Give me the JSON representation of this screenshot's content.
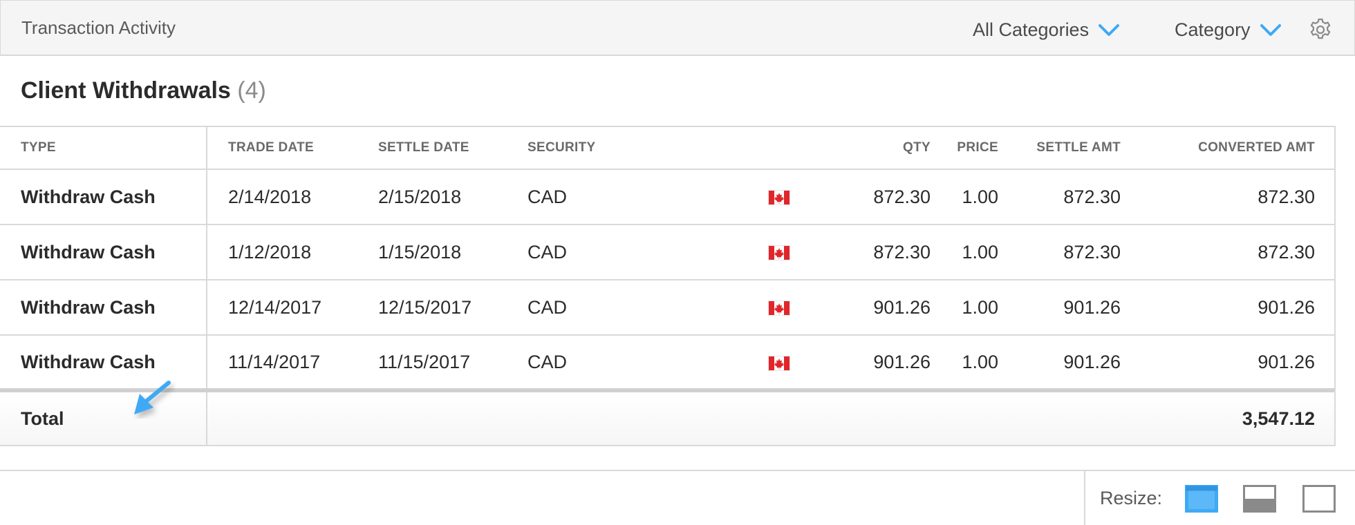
{
  "header": {
    "title": "Transaction Activity",
    "filter_all_categories": "All Categories",
    "filter_category": "Category"
  },
  "section": {
    "title": "Client Withdrawals",
    "count": "(4)"
  },
  "table": {
    "columns": [
      "TYPE",
      "TRADE DATE",
      "SETTLE DATE",
      "SECURITY",
      "QTY",
      "PRICE",
      "SETTLE AMT",
      "CONVERTED AMT"
    ],
    "rows": [
      {
        "type": "Withdraw Cash",
        "trade_date": "2/14/2018",
        "settle_date": "2/15/2018",
        "security": "CAD",
        "flag": "canada-flag-icon",
        "qty": "872.30",
        "price": "1.00",
        "settle_amt": "872.30",
        "converted_amt": "872.30"
      },
      {
        "type": "Withdraw Cash",
        "trade_date": "1/12/2018",
        "settle_date": "1/15/2018",
        "security": "CAD",
        "flag": "canada-flag-icon",
        "qty": "872.30",
        "price": "1.00",
        "settle_amt": "872.30",
        "converted_amt": "872.30"
      },
      {
        "type": "Withdraw Cash",
        "trade_date": "12/14/2017",
        "settle_date": "12/15/2017",
        "security": "CAD",
        "flag": "canada-flag-icon",
        "qty": "901.26",
        "price": "1.00",
        "settle_amt": "901.26",
        "converted_amt": "901.26"
      },
      {
        "type": "Withdraw Cash",
        "trade_date": "11/14/2017",
        "settle_date": "11/15/2017",
        "security": "CAD",
        "flag": "canada-flag-icon",
        "qty": "901.26",
        "price": "1.00",
        "settle_amt": "901.26",
        "converted_amt": "901.26"
      }
    ],
    "total_label": "Total",
    "total_value": "3,547.12"
  },
  "footer": {
    "resize_label": "Resize:"
  },
  "colors": {
    "accent": "#3fa9f5",
    "border": "#d9d9d9",
    "header_bg": "#f5f5f5",
    "flag_red": "#e0262b"
  },
  "icons": {
    "dropdown": "chevron-down-icon",
    "settings": "gear-icon",
    "annotation": "arrow-icon"
  }
}
